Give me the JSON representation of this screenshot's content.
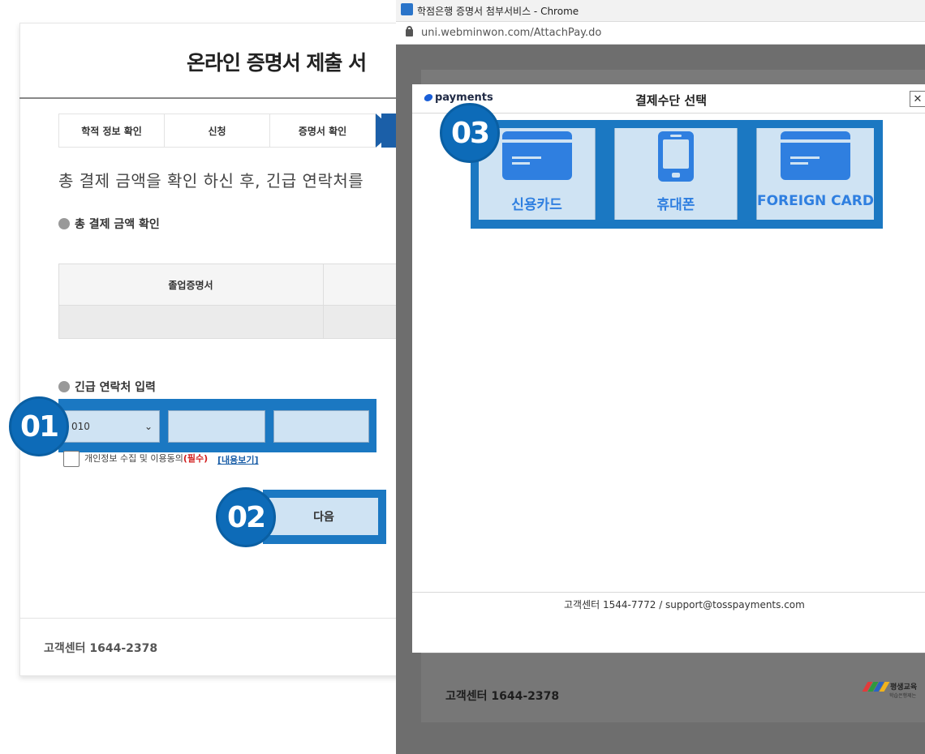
{
  "background_page": {
    "title": "온라인 증명서 제출 서",
    "steps": [
      "학적 정보 확인",
      "신청",
      "증명서 확인"
    ],
    "notice": "총 결제 금액을 확인 하신 후, 긴급 연락처를",
    "total_section_heading": "총 결제 금액 확인",
    "table_header": "졸업증명서",
    "contact_section_heading": "긴급 연락처 입력",
    "phone_prefix_selected": "010",
    "consent_text": "개인정보 수집 및 이용동의",
    "consent_required": "(필수)",
    "consent_link": "[내용보기]",
    "next_button": "다음",
    "footer": "고객센터 1644-2378"
  },
  "badges": {
    "step1": "01",
    "step2": "02",
    "step3": "03"
  },
  "chrome_window": {
    "title": "학점은행 증명서 첨부서비스 - Chrome",
    "url": "uni.webminwon.com/AttachPay.do",
    "footer": "고객센터 1644-2378",
    "logo_text": "평생교육",
    "logo_sub": "학습은행제는 "
  },
  "payments_modal": {
    "brand": "payments",
    "title": "결제수단 선택",
    "close_label": "✕",
    "options": [
      {
        "label": "신용카드",
        "icon": "credit-card-icon"
      },
      {
        "label": "휴대폰",
        "icon": "mobile-phone-icon"
      },
      {
        "label": "FOREIGN CARD",
        "icon": "credit-card-icon"
      }
    ],
    "footer": "고객센터 1544-7772 / support@tosspayments.com"
  },
  "colors": {
    "highlight_blue": "#1b78c2",
    "highlight_fill": "#cfe3f3",
    "badge_blue": "#0d6bb8",
    "pay_blue": "#2f7fe0"
  }
}
